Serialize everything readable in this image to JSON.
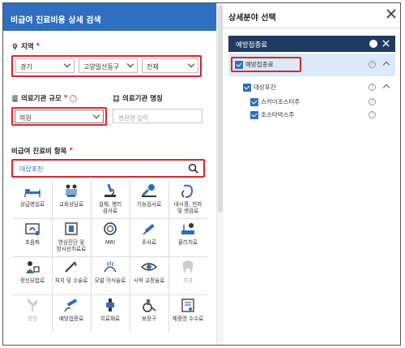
{
  "left": {
    "title": "비급여 진료비용 상세 검색",
    "region": {
      "label": "지역",
      "required": "*",
      "sido": "경기",
      "sigungu": "고양일산동구",
      "dong": "전체"
    },
    "scale": {
      "label": "의료기관 규모",
      "required": "*",
      "value": "의원"
    },
    "name": {
      "label": "의료기관 명칭",
      "placeholder": "병원명 입력"
    },
    "items": {
      "label": "비급여 진료비 항목",
      "required": "*",
      "search_value": "대상포진"
    },
    "categories": [
      {
        "label": "상급병실료",
        "icon": "hospital-bed-icon",
        "dim": false
      },
      {
        "label": "교육상담료",
        "icon": "counseling-icon",
        "dim": false
      },
      {
        "label": "검체, 병리\n검사료",
        "icon": "microscope-icon",
        "dim": false
      },
      {
        "label": "기능검사료",
        "icon": "function-test-icon",
        "dim": false
      },
      {
        "label": "내시경, 천자\n및 생검료",
        "icon": "endoscope-icon",
        "dim": false
      },
      {
        "label": "초음파",
        "icon": "ultrasound-icon",
        "dim": false
      },
      {
        "label": "영상진단 및\n방사선치료료",
        "icon": "radiology-icon",
        "dim": false
      },
      {
        "label": "MRI",
        "icon": "mri-icon",
        "dim": false
      },
      {
        "label": "주사료",
        "icon": "syringe-icon",
        "dim": false
      },
      {
        "label": "물리치료",
        "icon": "physical-therapy-icon",
        "dim": false
      },
      {
        "label": "정신요법료",
        "icon": "psychotherapy-icon",
        "dim": false
      },
      {
        "label": "처치 및 수술료",
        "icon": "surgery-icon",
        "dim": false
      },
      {
        "label": "모발 이식술료",
        "icon": "hair-transplant-icon",
        "dim": false
      },
      {
        "label": "시력 교정술료",
        "icon": "eye-icon",
        "dim": false
      },
      {
        "label": "치과",
        "icon": "tooth-icon",
        "dim": true
      },
      {
        "label": "한방",
        "icon": "herbal-icon",
        "dim": true
      },
      {
        "label": "예방접종료",
        "icon": "vaccine-icon",
        "dim": false
      },
      {
        "label": "치료재료",
        "icon": "implant-icon",
        "dim": false
      },
      {
        "label": "보장구",
        "icon": "wheelchair-icon",
        "dim": false
      },
      {
        "label": "제증명 수수료",
        "icon": "certificate-icon",
        "dim": false
      }
    ]
  },
  "right": {
    "title": "상세분야 선택",
    "bar_label": "예방접종료",
    "tree": [
      {
        "label": "예방접종료",
        "level": 0
      },
      {
        "label": "대상포진",
        "level": 1
      },
      {
        "label": "스카이조스터주",
        "level": 2
      },
      {
        "label": "조스타박스주",
        "level": 2
      }
    ]
  },
  "colors": {
    "accent": "#2f6ec0",
    "dark_bar": "#1f3b63",
    "highlight": "#d9262c"
  }
}
